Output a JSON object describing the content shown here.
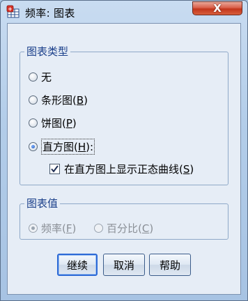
{
  "window": {
    "title": "频率: 图表",
    "close_symbol": "X",
    "app_icon": "spss-table-icon"
  },
  "chart_type_group": {
    "legend": "图表类型",
    "options": [
      {
        "label": "无",
        "mnemonic": "",
        "checked": false
      },
      {
        "label": "条形图(",
        "mnemonic": "B",
        "suffix": ")",
        "checked": false
      },
      {
        "label": "饼图(",
        "mnemonic": "P",
        "suffix": ")",
        "checked": false
      },
      {
        "label": "直方图(",
        "mnemonic": "H",
        "suffix": "):",
        "checked": true
      }
    ],
    "normal_curve": {
      "label": "在直方图上显示正态曲线(",
      "mnemonic": "S",
      "suffix": ")",
      "checked": true
    }
  },
  "chart_values_group": {
    "legend": "图表值",
    "options": [
      {
        "label": "频率(",
        "mnemonic": "F",
        "suffix": ")",
        "checked": true,
        "enabled": false
      },
      {
        "label": "百分比(",
        "mnemonic": "C",
        "suffix": ")",
        "checked": false,
        "enabled": false
      }
    ]
  },
  "buttons": {
    "continue": "继续",
    "cancel": "取消",
    "help": "帮助"
  }
}
